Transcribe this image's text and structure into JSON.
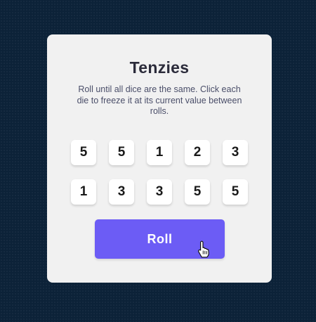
{
  "game": {
    "title": "Tenzies",
    "instructions": "Roll until all dice are the same. Click each die to freeze it at its current value between rolls.",
    "dice": [
      "5",
      "5",
      "1",
      "2",
      "3",
      "1",
      "3",
      "3",
      "5",
      "5"
    ],
    "roll_label": "Roll"
  },
  "colors": {
    "background": "#0c2238",
    "card": "#f1f1f1",
    "accent": "#6c5cf5",
    "die_face": "#ffffff"
  },
  "icons": {
    "cursor": "hand-pointer-cursor-icon"
  }
}
